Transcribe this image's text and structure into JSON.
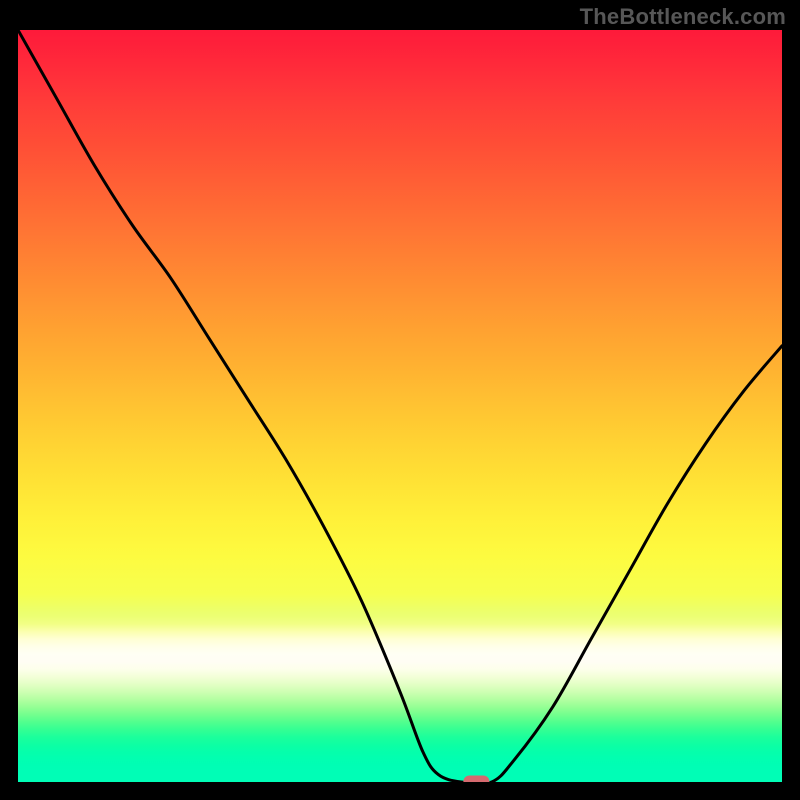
{
  "watermark": "TheBottleneck.com",
  "chart_data": {
    "type": "line",
    "title": "",
    "xlabel": "",
    "ylabel": "",
    "xlim": [
      0,
      100
    ],
    "ylim": [
      0,
      100
    ],
    "grid": false,
    "background_gradient": {
      "direction": "vertical",
      "stops": [
        {
          "pos": 0,
          "color": "#fe1a3a",
          "meaning": "high"
        },
        {
          "pos": 50,
          "color": "#ffc332"
        },
        {
          "pos": 70,
          "color": "#fdfb40"
        },
        {
          "pos": 82,
          "color": "#fffff4"
        },
        {
          "pos": 100,
          "color": "#00feb6",
          "meaning": "low"
        }
      ]
    },
    "series": [
      {
        "name": "bottleneck-curve",
        "color": "#000000",
        "x": [
          0,
          5,
          10,
          15,
          20,
          25,
          30,
          35,
          40,
          45,
          50,
          53,
          55,
          58,
          62,
          65,
          70,
          75,
          80,
          85,
          90,
          95,
          100
        ],
        "y": [
          100,
          91,
          82,
          74,
          67,
          59,
          51,
          43,
          34,
          24,
          12,
          4,
          1,
          0,
          0,
          3,
          10,
          19,
          28,
          37,
          45,
          52,
          58
        ]
      }
    ],
    "marker": {
      "name": "optimal-point",
      "x": 60,
      "y": 0,
      "color": "#d56a6f",
      "shape": "rounded-rect"
    }
  }
}
